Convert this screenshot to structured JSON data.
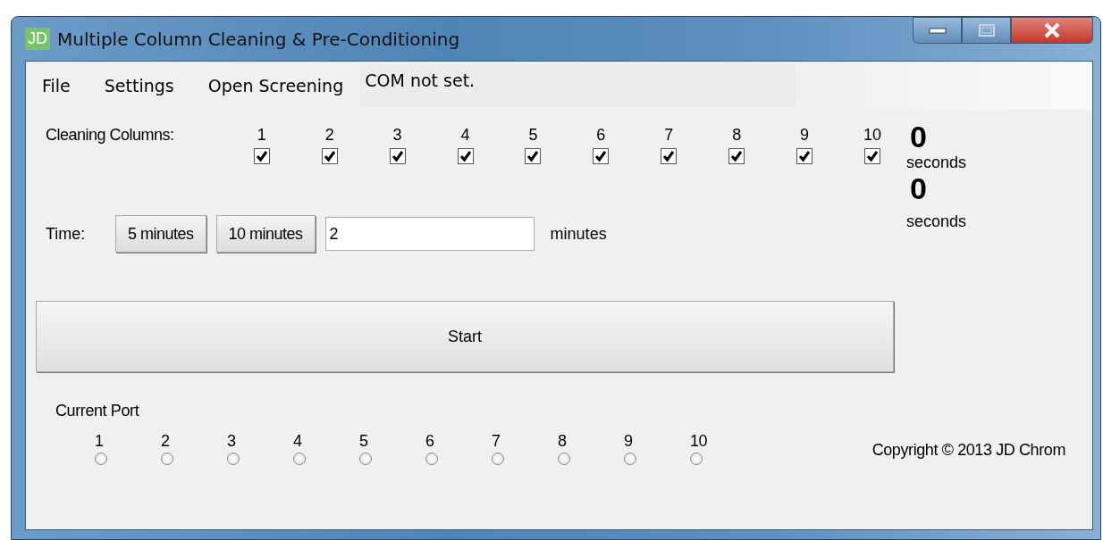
{
  "window": {
    "icon_text": "JD",
    "title": "Multiple Column Cleaning & Pre-Conditioning"
  },
  "menu": [
    "File",
    "Settings",
    "Open Screening"
  ],
  "status": "COM not set.",
  "cleaning": {
    "label": "Cleaning Columns:",
    "columns": [
      {
        "label": "1",
        "checked": true
      },
      {
        "label": "2",
        "checked": true
      },
      {
        "label": "3",
        "checked": true
      },
      {
        "label": "4",
        "checked": true
      },
      {
        "label": "5",
        "checked": true
      },
      {
        "label": "6",
        "checked": true
      },
      {
        "label": "7",
        "checked": true
      },
      {
        "label": "8",
        "checked": true
      },
      {
        "label": "9",
        "checked": true
      },
      {
        "label": "10",
        "checked": true
      }
    ]
  },
  "timers": [
    {
      "value": "0",
      "unit": "seconds"
    },
    {
      "value": "0",
      "unit": "seconds"
    }
  ],
  "time": {
    "label": "Time:",
    "presets": [
      "5 minutes",
      "10 minutes"
    ],
    "value": "2",
    "unit": "minutes"
  },
  "start": "Start",
  "port": {
    "label": "Current Port",
    "ports": [
      {
        "label": "1",
        "selected": false
      },
      {
        "label": "2",
        "selected": false
      },
      {
        "label": "3",
        "selected": false
      },
      {
        "label": "4",
        "selected": false
      },
      {
        "label": "5",
        "selected": false
      },
      {
        "label": "6",
        "selected": false
      },
      {
        "label": "7",
        "selected": false
      },
      {
        "label": "8",
        "selected": false
      },
      {
        "label": "9",
        "selected": false
      },
      {
        "label": "10",
        "selected": false
      }
    ]
  },
  "copyright": "Copyright © 2013 JD Chrom"
}
